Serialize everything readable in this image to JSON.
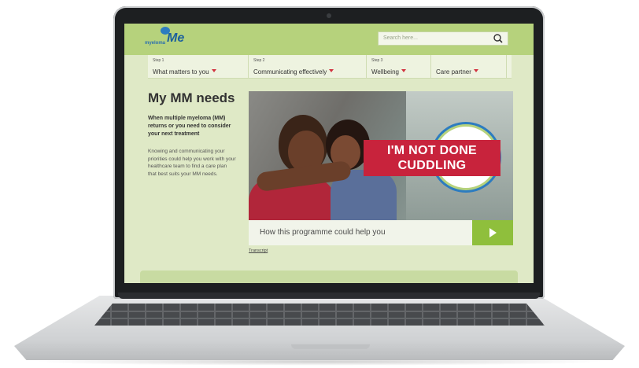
{
  "site": {
    "logo_small": "myeloma",
    "logo_big": "Me"
  },
  "search": {
    "placeholder": "Search here..."
  },
  "nav": {
    "items": [
      {
        "step": "Step 1",
        "label": "What matters to you"
      },
      {
        "step": "Step 2",
        "label": "Communicating effectively"
      },
      {
        "step": "Step 3",
        "label": "Wellbeing"
      },
      {
        "step": "",
        "label": "Care partner"
      }
    ]
  },
  "main": {
    "title": "My MM needs",
    "intro": "When multiple myeloma (MM) returns or you need to consider your next treatment",
    "body": "Knowing and communicating your priorities could help you work with your healthcare team to find a care plan that best suits your MM needs."
  },
  "hero": {
    "banner_line1": "I'M NOT DONE",
    "banner_line2": "CUDDLING"
  },
  "cta": {
    "label": "How this programme could help you"
  },
  "transcript": {
    "label": "Transcript"
  },
  "colors": {
    "header_green": "#b6d27c",
    "accent_red": "#c8233c",
    "play_green": "#8fbf3c",
    "brand_blue": "#2d7cc0"
  }
}
